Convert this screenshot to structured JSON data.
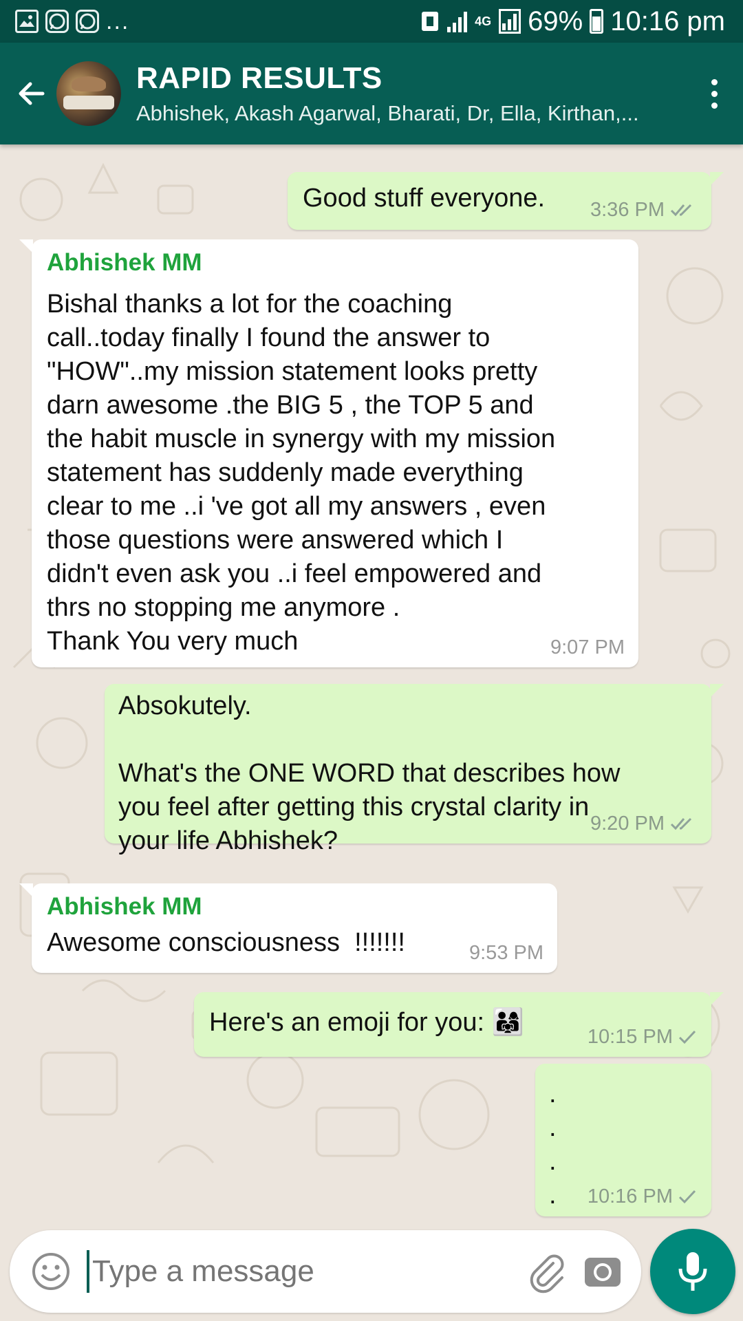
{
  "status_bar": {
    "icons_left": [
      "image-icon",
      "whatsapp-icon",
      "whatsapp-icon"
    ],
    "more": "...",
    "network": "4G",
    "battery": "69%",
    "time": "10:16 pm"
  },
  "header": {
    "title": "RAPID RESULTS",
    "subtitle": "Abhishek, Akash Agarwal, Bharati, Dr, Ella, Kirthan,...",
    "back_icon": "arrow-left-icon",
    "menu_icon": "more-vert-icon"
  },
  "messages": [
    {
      "type": "out",
      "text": "Good stuff everyone.",
      "time": "3:36 PM",
      "status": "read"
    },
    {
      "type": "in",
      "sender": "Abhishek MM",
      "text": "Bishal thanks a lot for the coaching\ncall..today finally I found the answer to\n\"HOW\"..my mission statement looks pretty\ndarn awesome .the BIG 5 , the TOP 5 and\nthe habit muscle in synergy with my mission\nstatement has suddenly made everything\nclear to me ..i 've got all my answers , even\nthose questions were answered which I\ndidn't even ask you ..i feel empowered and\nthrs no stopping me anymore .\nThank You very much",
      "time": "9:07 PM"
    },
    {
      "type": "out",
      "text": "Absokutely.\n\nWhat's the ONE WORD that describes how\nyou feel after getting this crystal clarity in\nyour life Abhishek?",
      "time": "9:20 PM",
      "status": "read"
    },
    {
      "type": "in",
      "sender": "Abhishek MM",
      "text": "Awesome consciousness  !!!!!!!",
      "time": "9:53 PM"
    },
    {
      "type": "out",
      "text": "Here's an emoji for you: 👨‍👩‍👧",
      "time": "10:15 PM",
      "status": "sent"
    },
    {
      "type": "out",
      "text": ".\n.\n.\n.",
      "time": "10:16 PM",
      "status": "sent"
    }
  ],
  "composer": {
    "placeholder": "Type a message",
    "emoji_icon": "emoji-icon",
    "attach_icon": "paperclip-icon",
    "camera_icon": "camera-icon",
    "mic_icon": "mic-icon"
  },
  "colors": {
    "status_bar": "#054d44",
    "toolbar": "#075e54",
    "outgoing_bubble": "#dcf8c6",
    "incoming_bubble": "#ffffff",
    "sender_name": "#1fa33c",
    "mic_button": "#00897b",
    "read_tick": "#4fc3f7",
    "chat_bg": "#ece5dd"
  }
}
